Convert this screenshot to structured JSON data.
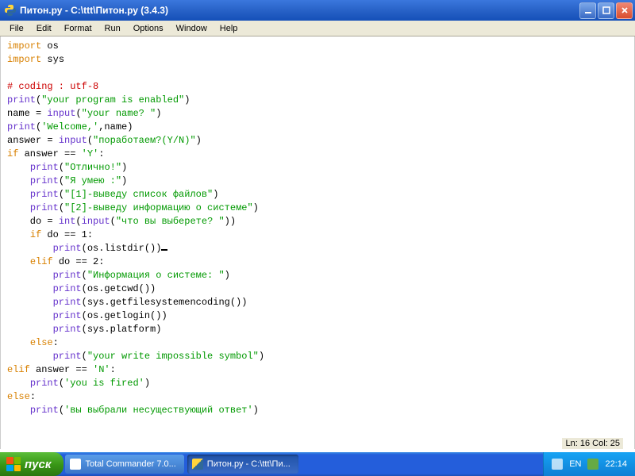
{
  "window": {
    "title": "Питон.ру - C:\\ttt\\Питон.ру (3.4.3)"
  },
  "menu": {
    "file": "File",
    "edit": "Edit",
    "format": "Format",
    "run": "Run",
    "options": "Options",
    "window": "Window",
    "help": "Help"
  },
  "status": {
    "ln": "Ln: 16",
    "col": "Col: 25"
  },
  "code": {
    "l1_kw": "import",
    "l1_mod": " os",
    "l2_kw": "import",
    "l2_mod": " sys",
    "l4": "# coding : utf-8",
    "l5_fn": "print",
    "l5_p1": "(",
    "l5_str": "\"your program is enabled\"",
    "l5_p2": ")",
    "l6a": "name = ",
    "l6_fn": "input",
    "l6_p1": "(",
    "l6_str": "\"your name? \"",
    "l6_p2": ")",
    "l7_fn": "print",
    "l7_p1": "(",
    "l7_str": "'Welcome,'",
    "l7_p2": ",name)",
    "l8a": "answer = ",
    "l8_fn": "input",
    "l8_p1": "(",
    "l8_str": "\"поработаем?(Y/N)\"",
    "l8_p2": ")",
    "l9_kw": "if",
    "l9_txt": " answer == ",
    "l9_str": "'Y'",
    "l9_c": ":",
    "l10_sp": "    ",
    "l10_fn": "print",
    "l10_p1": "(",
    "l10_str": "\"Отлично!\"",
    "l10_p2": ")",
    "l11_sp": "    ",
    "l11_fn": "print",
    "l11_p1": "(",
    "l11_str": "\"Я умею :\"",
    "l11_p2": ")",
    "l12_sp": "    ",
    "l12_fn": "print",
    "l12_p1": "(",
    "l12_str": "\"[1]-выведу список файлов\"",
    "l12_p2": ")",
    "l13_sp": "    ",
    "l13_fn": "print",
    "l13_p1": "(",
    "l13_str": "\"[2]-выведу информацию о системе\"",
    "l13_p2": ")",
    "l14_sp": "    do = ",
    "l14_fn1": "int",
    "l14_p1": "(",
    "l14_fn2": "input",
    "l14_p2": "(",
    "l14_str": "\"что вы выберете? \"",
    "l14_p3": "))",
    "l15_sp": "    ",
    "l15_kw": "if",
    "l15_txt": " do == 1:",
    "l16_sp": "        ",
    "l16_fn": "print",
    "l16_p1": "(os.listdir())",
    "l17_sp": "    ",
    "l17_kw": "elif",
    "l17_txt": " do == 2:",
    "l18_sp": "        ",
    "l18_fn": "print",
    "l18_p1": "(",
    "l18_str": "\"Информация о системе: \"",
    "l18_p2": ")",
    "l19_sp": "        ",
    "l19_fn": "print",
    "l19_p1": "(os.getcwd())",
    "l20_sp": "        ",
    "l20_fn": "print",
    "l20_p1": "(sys.getfilesystemencoding())",
    "l21_sp": "        ",
    "l21_fn": "print",
    "l21_p1": "(os.getlogin())",
    "l22_sp": "        ",
    "l22_fn": "print",
    "l22_p1": "(sys.platform)",
    "l23_sp": "    ",
    "l23_kw": "else",
    "l23_c": ":",
    "l24_sp": "        ",
    "l24_fn": "print",
    "l24_p1": "(",
    "l24_str": "\"your write impossible symbol\"",
    "l24_p2": ")",
    "l25_kw": "elif",
    "l25_txt": " answer == ",
    "l25_str": "'N'",
    "l25_c": ":",
    "l26_sp": "    ",
    "l26_fn": "print",
    "l26_p1": "(",
    "l26_str": "'you is fired'",
    "l26_p2": ")",
    "l27_kw": "else",
    "l27_c": ":",
    "l28_sp": "    ",
    "l28_fn": "print",
    "l28_p1": "(",
    "l28_str": "'вы выбрали несуществующий ответ'",
    "l28_p2": ")"
  },
  "taskbar": {
    "start": "пуск",
    "task1": "Total Commander 7.0...",
    "task2": "Питон.ру - C:\\ttt\\Пи...",
    "lang": "EN",
    "clock": "22:14"
  }
}
